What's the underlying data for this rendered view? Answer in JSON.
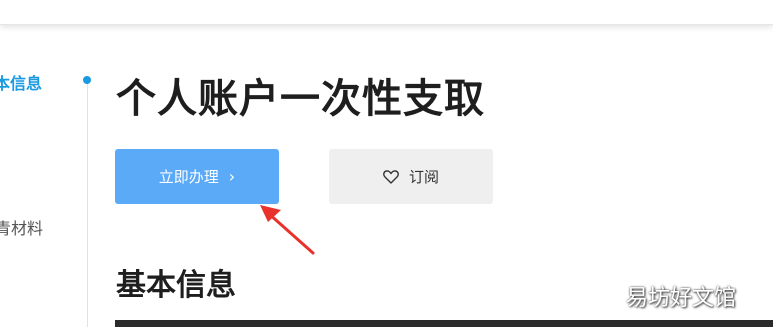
{
  "sidebar": {
    "items": [
      {
        "label": "本信息",
        "active": true
      },
      {
        "label": "青材料",
        "active": false
      }
    ]
  },
  "main": {
    "title": "个人账户一次性支取",
    "apply_button": "立即办理",
    "apply_chevron": "›",
    "subscribe_button": "订阅",
    "section_title": "基本信息"
  },
  "watermark": "易坊好文馆",
  "colors": {
    "accent": "#1a9ae0",
    "primary_button": "#5aaaf8",
    "secondary_button": "#efefef",
    "annotation_arrow": "#e8322b"
  },
  "icons": {
    "subscribe": "heart-icon",
    "apply": "chevron-right-icon"
  }
}
